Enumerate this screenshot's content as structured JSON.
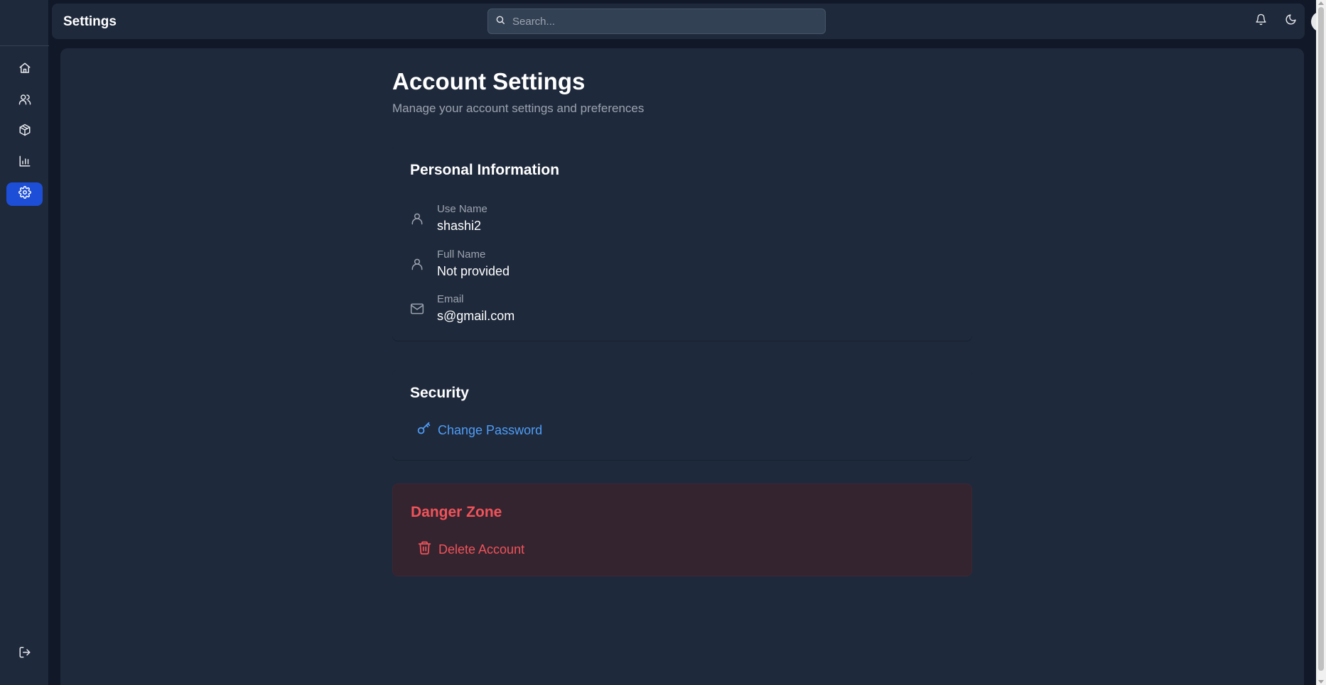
{
  "topbar": {
    "title": "Settings",
    "search_placeholder": "Search..."
  },
  "sidebar": {
    "items": [
      {
        "name": "home",
        "icon": "home-icon"
      },
      {
        "name": "users",
        "icon": "users-icon"
      },
      {
        "name": "products",
        "icon": "box-icon"
      },
      {
        "name": "analytics",
        "icon": "bar-chart-icon"
      },
      {
        "name": "settings",
        "icon": "gear-icon",
        "active": true
      }
    ],
    "logout_icon": "logout-icon"
  },
  "page": {
    "title": "Account Settings",
    "subtitle": "Manage your account settings and preferences"
  },
  "personal": {
    "title": "Personal Information",
    "fields": [
      {
        "label": "Use Name",
        "value": "shashi2",
        "icon": "user-icon"
      },
      {
        "label": "Full Name",
        "value": "Not provided",
        "icon": "user-icon"
      },
      {
        "label": "Email",
        "value": "s@gmail.com",
        "icon": "mail-icon"
      }
    ]
  },
  "security": {
    "title": "Security",
    "change_password": "Change Password"
  },
  "danger": {
    "title": "Danger Zone",
    "delete_account": "Delete Account"
  },
  "colors": {
    "background": "#111827",
    "panel": "#1e293b",
    "accent": "#1d4ed8",
    "link": "#4f9df7",
    "danger": "#f0535a",
    "danger_bg": "#34242f"
  }
}
